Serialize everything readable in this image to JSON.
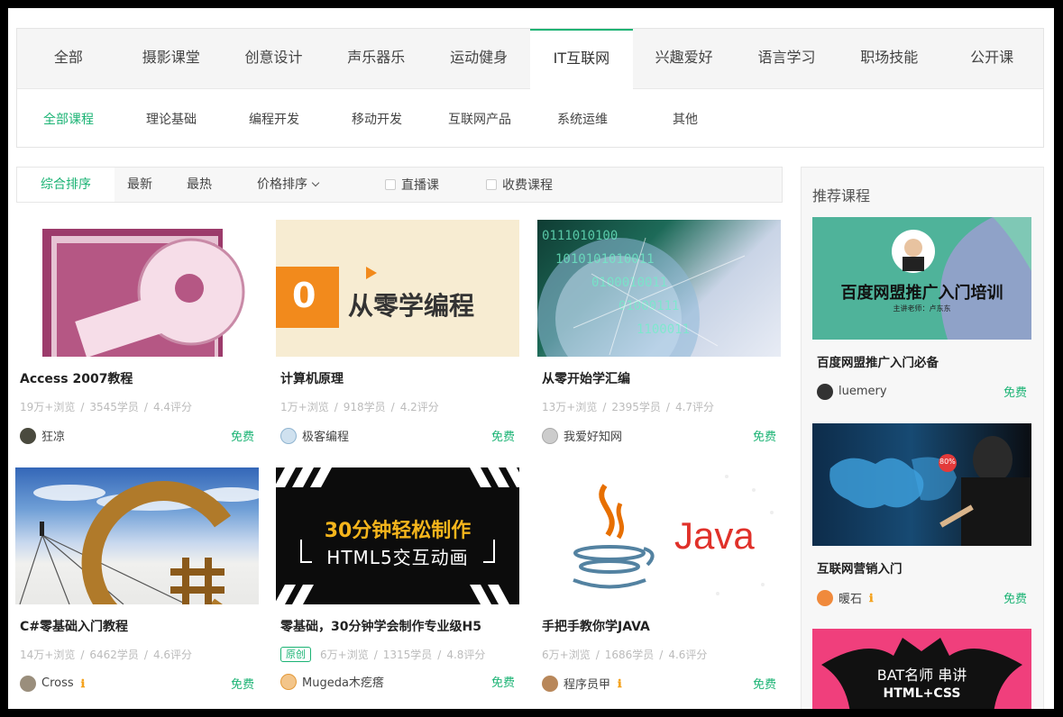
{
  "categories": [
    "全部",
    "摄影课堂",
    "创意设计",
    "声乐器乐",
    "运动健身",
    "IT互联网",
    "兴趣爱好",
    "语言学习",
    "职场技能",
    "公开课"
  ],
  "subcategories": [
    "全部课程",
    "理论基础",
    "编程开发",
    "移动开发",
    "互联网产品",
    "系统运维",
    "其他"
  ],
  "sort": {
    "items": [
      "综合排序",
      "最新",
      "最热",
      "价格排序"
    ],
    "checks": [
      "直播课",
      "收费课程"
    ]
  },
  "courses": [
    {
      "title": "Access 2007教程",
      "views": "19万+浏览",
      "students": "3545学员",
      "rating": "4.4评分",
      "author": "狂凉",
      "price": "免费"
    },
    {
      "title": "计算机原理",
      "views": "1万+浏览",
      "students": "918学员",
      "rating": "4.2评分",
      "author": "极客编程",
      "price": "免费",
      "thumb_big": "0",
      "thumb_text": "从零学编程"
    },
    {
      "title": "从零开始学汇编",
      "views": "13万+浏览",
      "students": "2395学员",
      "rating": "4.7评分",
      "author": "我爱好知网",
      "price": "免费"
    },
    {
      "title": "C#零基础入门教程",
      "views": "14万+浏览",
      "students": "6462学员",
      "rating": "4.6评分",
      "author": "Cross",
      "price": "免费"
    },
    {
      "title": "零基础，30分钟学会制作专业级H5",
      "tag": "原创",
      "views": "6万+浏览",
      "students": "1315学员",
      "rating": "4.8评分",
      "author": "Mugeda木疙瘩",
      "price": "免费",
      "thumb_line1": "30分钟轻松制作",
      "thumb_line2": "HTML5交互动画"
    },
    {
      "title": "手把手教你学JAVA",
      "views": "6万+浏览",
      "students": "1686学员",
      "rating": "4.6评分",
      "author": "程序员甲",
      "price": "免费",
      "thumb_text": "Java"
    }
  ],
  "sidebar": {
    "title": "推荐课程",
    "items": [
      {
        "title": "百度网盟推广入门必备",
        "author": "luemery",
        "price": "免费",
        "thumb_text": "百度网盟推广入门培训",
        "thumb_sub": "主讲老师：卢东东"
      },
      {
        "title": "互联网营销入门",
        "author": "暖石",
        "price": "免费",
        "thumb_text": "80%"
      },
      {
        "title": "",
        "author": "",
        "price": "",
        "thumb_text": "BAT名师 串讲",
        "thumb_sub": "HTML+CSS"
      }
    ]
  },
  "colors": {
    "accent": "#1bb374",
    "badge": "#f4a21d"
  },
  "icons": {
    "info_badge": "ℹ"
  }
}
